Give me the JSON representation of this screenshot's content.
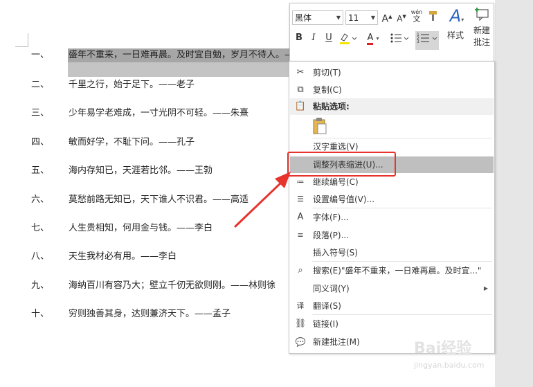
{
  "document": {
    "lines": [
      {
        "num": "一、",
        "text": "盛年不重来，一日难再晨。及时宜自勉，岁月不待人。——陶渊明"
      },
      {
        "num": "二、",
        "text": "千里之行，始于足下。——老子"
      },
      {
        "num": "三、",
        "text": "少年易学老难成，一寸光阴不可轻。——朱熹"
      },
      {
        "num": "四、",
        "text": "敏而好学，不耻下问。——孔子"
      },
      {
        "num": "五、",
        "text": "海内存知已，天涯若比邻。——王勃"
      },
      {
        "num": "六、",
        "text": "莫愁前路无知已，天下谁人不识君。——高适"
      },
      {
        "num": "七、",
        "text": "人生贵相知，何用金与钱。——李白"
      },
      {
        "num": "八、",
        "text": "天生我材必有用。——李白"
      },
      {
        "num": "九、",
        "text": "海纳百川有容乃大；壁立千仞无欲则刚。——林则徐"
      },
      {
        "num": "十、",
        "text": "穷则独善其身，达则兼济天下。——孟子"
      }
    ]
  },
  "mini_toolbar": {
    "font_name": "黑体",
    "font_size": "11",
    "grow_font": "A",
    "shrink_font": "A",
    "phonetic_guide": "wén",
    "bold": "B",
    "italic": "I",
    "underline": "U",
    "font_color": "A",
    "styles_label": "样式",
    "new_comment_label_1": "新建",
    "new_comment_label_2": "批注",
    "highlight_color": "#f5e400",
    "font_color_value": "#e02020"
  },
  "context_menu": {
    "items": [
      {
        "label": "剪切(T)",
        "icon": "scissors-icon"
      },
      {
        "label": "复制(C)",
        "icon": "copy-icon"
      },
      {
        "label": "粘贴选项:",
        "icon": "paste-icon"
      },
      {
        "label": "汉字重选(V)",
        "icon": ""
      },
      {
        "label": "调整列表缩进(U)...",
        "icon": ""
      },
      {
        "label": "继续编号(C)",
        "icon": "continue-numbering-icon"
      },
      {
        "label": "设置编号值(V)...",
        "icon": "set-numbering-value-icon"
      },
      {
        "label": "字体(F)...",
        "icon": "font-icon"
      },
      {
        "label": "段落(P)...",
        "icon": "paragraph-icon"
      },
      {
        "label": "插入符号(S)",
        "icon": ""
      },
      {
        "label": "搜索(E)\"盛年不重来，一日难再晨。及时宜...\"",
        "icon": "search-icon"
      },
      {
        "label": "同义词(Y)",
        "icon": ""
      },
      {
        "label": "翻译(S)",
        "icon": "translate-icon"
      },
      {
        "label": "链接(I)",
        "icon": "link-icon"
      },
      {
        "label": "新建批注(M)",
        "icon": "new-comment-icon"
      }
    ],
    "highlighted_index": 4,
    "annotation_color": "#e8332d"
  },
  "watermark": {
    "brand": "Bai经验",
    "url": "jingyan.baidu.com"
  }
}
